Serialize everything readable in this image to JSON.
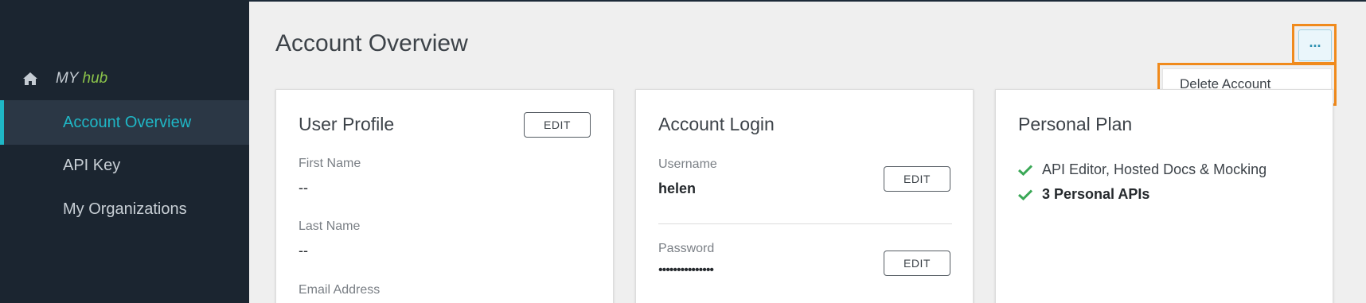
{
  "sidebar": {
    "brand_my": "MY",
    "brand_hub": "hub",
    "items": [
      {
        "label": "Account Overview",
        "active": true
      },
      {
        "label": "API Key",
        "active": false
      },
      {
        "label": "My Organizations",
        "active": false
      }
    ]
  },
  "header": {
    "title": "Account Overview",
    "more_label": "...",
    "menu": {
      "delete_label": "Delete Account"
    }
  },
  "user_profile": {
    "title": "User Profile",
    "edit_label": "EDIT",
    "first_name_label": "First Name",
    "first_name_value": "--",
    "last_name_label": "Last Name",
    "last_name_value": "--",
    "email_label": "Email Address"
  },
  "account_login": {
    "title": "Account Login",
    "username_label": "Username",
    "username_value": "helen",
    "username_edit_label": "EDIT",
    "password_label": "Password",
    "password_value": "•••••••••••••••",
    "password_edit_label": "EDIT"
  },
  "personal_plan": {
    "title": "Personal Plan",
    "features": [
      {
        "label": "API Editor, Hosted Docs & Mocking",
        "bold": false
      },
      {
        "label": "3 Personal APIs",
        "bold": true
      }
    ]
  },
  "colors": {
    "sidebar_bg": "#1b2530",
    "accent": "#1fb7c6",
    "hub_green": "#8bc34a",
    "check_green": "#3aa856",
    "highlight_orange": "#f08a1c"
  },
  "icons": {
    "home": "home-icon",
    "check": "check-icon"
  }
}
